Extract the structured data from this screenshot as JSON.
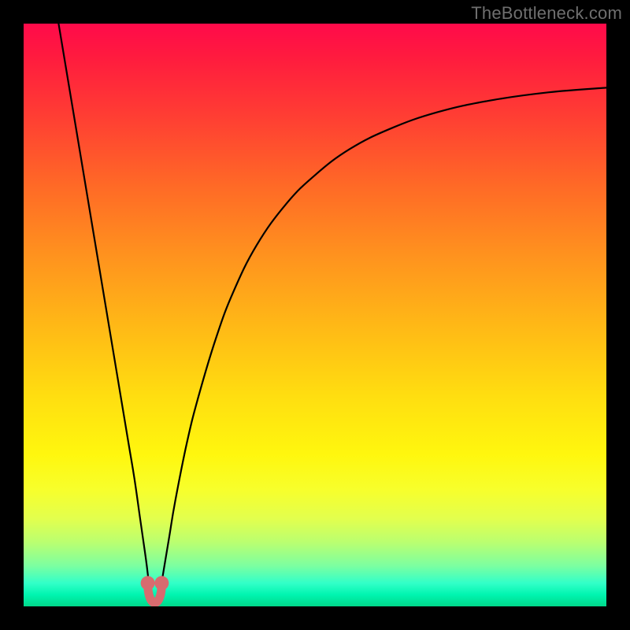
{
  "watermark": "TheBottleneck.com",
  "colors": {
    "curve": "#000000",
    "marker": "#d86b6f",
    "frame": "#000000"
  },
  "chart_data": {
    "type": "line",
    "title": "",
    "xlabel": "",
    "ylabel": "",
    "xlim": [
      0,
      100
    ],
    "ylim": [
      0,
      100
    ],
    "grid": false,
    "legend": false,
    "series": [
      {
        "name": "bottleneck-curve",
        "x": [
          6,
          8,
          10,
          12,
          14,
          16,
          18,
          19,
          20,
          21,
          21.5,
          22,
          22.5,
          23,
          23.5,
          24,
          25,
          26,
          28,
          30,
          33,
          36,
          40,
          45,
          50,
          56,
          63,
          71,
          80,
          90,
          100
        ],
        "y": [
          100,
          88,
          76,
          64,
          52,
          40,
          28,
          22,
          15,
          8,
          4,
          1,
          0,
          1,
          3,
          6,
          12,
          18,
          28,
          36,
          46,
          54,
          62,
          69,
          74,
          78.5,
          82,
          84.8,
          86.8,
          88.2,
          89
        ]
      }
    ],
    "markers": [
      {
        "name": "min-left",
        "x": 21.3,
        "y": 4
      },
      {
        "name": "min-right",
        "x": 23.7,
        "y": 4
      }
    ],
    "marker_link": {
      "from": "min-left",
      "to": "min-right",
      "path_y": [
        4,
        0.5,
        0.5,
        4
      ]
    }
  }
}
